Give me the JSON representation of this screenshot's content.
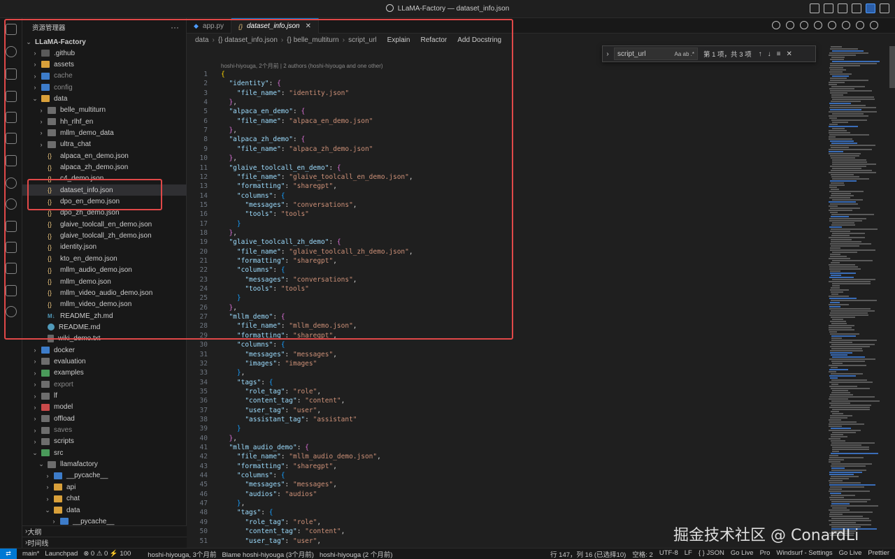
{
  "window": {
    "title": "LLaMA-Factory — dataset_info.json"
  },
  "sidebar": {
    "header": "资源管理器",
    "more": "···",
    "root": "LLaMA-Factory",
    "items": [
      {
        "label": ".github",
        "kind": "folder-github",
        "chev": "›",
        "indent": 1
      },
      {
        "label": "assets",
        "kind": "folder-orange",
        "chev": "›",
        "indent": 1
      },
      {
        "label": "cache",
        "kind": "folder-blue",
        "chev": "›",
        "indent": 1,
        "dim": true
      },
      {
        "label": "config",
        "kind": "folder-blue",
        "chev": "›",
        "indent": 1,
        "dim": true
      },
      {
        "label": "data",
        "kind": "folder-orange",
        "chev": "⌄",
        "indent": 1
      },
      {
        "label": "belle_multiturn",
        "kind": "folder",
        "chev": "›",
        "indent": 2
      },
      {
        "label": "hh_rlhf_en",
        "kind": "folder",
        "chev": "›",
        "indent": 2
      },
      {
        "label": "mllm_demo_data",
        "kind": "folder",
        "chev": "›",
        "indent": 2
      },
      {
        "label": "ultra_chat",
        "kind": "folder",
        "chev": "›",
        "indent": 2
      },
      {
        "label": "alpaca_en_demo.json",
        "kind": "json",
        "indent": 2
      },
      {
        "label": "alpaca_zh_demo.json",
        "kind": "json",
        "indent": 2
      },
      {
        "label": "c4_demo.json",
        "kind": "json",
        "indent": 2
      },
      {
        "label": "dataset_info.json",
        "kind": "json",
        "indent": 2,
        "selected": true
      },
      {
        "label": "dpo_en_demo.json",
        "kind": "json",
        "indent": 2
      },
      {
        "label": "dpo_zh_demo.json",
        "kind": "json",
        "indent": 2
      },
      {
        "label": "glaive_toolcall_en_demo.json",
        "kind": "json",
        "indent": 2
      },
      {
        "label": "glaive_toolcall_zh_demo.json",
        "kind": "json",
        "indent": 2
      },
      {
        "label": "identity.json",
        "kind": "json",
        "indent": 2
      },
      {
        "label": "kto_en_demo.json",
        "kind": "json",
        "indent": 2
      },
      {
        "label": "mllm_audio_demo.json",
        "kind": "json",
        "indent": 2
      },
      {
        "label": "mllm_demo.json",
        "kind": "json",
        "indent": 2
      },
      {
        "label": "mllm_video_audio_demo.json",
        "kind": "json",
        "indent": 2
      },
      {
        "label": "mllm_video_demo.json",
        "kind": "json",
        "indent": 2
      },
      {
        "label": "README_zh.md",
        "kind": "md",
        "indent": 2
      },
      {
        "label": "README.md",
        "kind": "info",
        "indent": 2
      },
      {
        "label": "wiki_demo.txt",
        "kind": "txt",
        "indent": 2
      },
      {
        "label": "docker",
        "kind": "folder-blue",
        "chev": "›",
        "indent": 1
      },
      {
        "label": "evaluation",
        "kind": "folder",
        "chev": "›",
        "indent": 1
      },
      {
        "label": "examples",
        "kind": "folder-green",
        "chev": "›",
        "indent": 1
      },
      {
        "label": "export",
        "kind": "folder",
        "chev": "›",
        "indent": 1,
        "dim": true
      },
      {
        "label": "lf",
        "kind": "folder",
        "chev": "›",
        "indent": 1
      },
      {
        "label": "model",
        "kind": "folder-red",
        "chev": "›",
        "indent": 1
      },
      {
        "label": "offload",
        "kind": "folder",
        "chev": "›",
        "indent": 1
      },
      {
        "label": "saves",
        "kind": "folder",
        "chev": "›",
        "indent": 1,
        "dim": true
      },
      {
        "label": "scripts",
        "kind": "folder",
        "chev": "›",
        "indent": 1
      },
      {
        "label": "src",
        "kind": "folder-green",
        "chev": "⌄",
        "indent": 1
      },
      {
        "label": "llamafactory",
        "kind": "folder",
        "chev": "⌄",
        "indent": 2
      },
      {
        "label": "__pycache__",
        "kind": "folder-blue",
        "chev": "›",
        "indent": 3
      },
      {
        "label": "api",
        "kind": "folder-orange",
        "chev": "›",
        "indent": 3
      },
      {
        "label": "chat",
        "kind": "folder-orange",
        "chev": "›",
        "indent": 3
      },
      {
        "label": "data",
        "kind": "folder-orange",
        "chev": "⌄",
        "indent": 3
      },
      {
        "label": "__pycache__",
        "kind": "folder-blue",
        "chev": "›",
        "indent": 4
      }
    ],
    "outline": "大纲",
    "timeline": "时间线"
  },
  "tabs": [
    {
      "label": "app.py",
      "icon": "python-icon"
    },
    {
      "label": "dataset_info.json",
      "icon": "json-icon",
      "active": true
    }
  ],
  "breadcrumb": {
    "items": [
      "data",
      "{} dataset_info.json",
      "{} belle_multiturn",
      "script_url"
    ],
    "actions": [
      "Explain",
      "Refactor",
      "Add Docstring"
    ]
  },
  "find": {
    "value": "script_url",
    "options": "Aa  ab  .*",
    "result": "第 1 项，共 3 项"
  },
  "blame_line": "hoshi-hiyouga, 2个月前 | 2 authors (hoshi-hiyouga and one other)",
  "code_lines": [
    {
      "n": "1",
      "t": "{"
    },
    {
      "n": "2",
      "t": "  \"identity\": {"
    },
    {
      "n": "3",
      "t": "    \"file_name\": \"identity.json\""
    },
    {
      "n": "4",
      "t": "  },"
    },
    {
      "n": "5",
      "t": "  \"alpaca_en_demo\": {"
    },
    {
      "n": "6",
      "t": "    \"file_name\": \"alpaca_en_demo.json\""
    },
    {
      "n": "7",
      "t": "  },"
    },
    {
      "n": "8",
      "t": "  \"alpaca_zh_demo\": {"
    },
    {
      "n": "9",
      "t": "    \"file_name\": \"alpaca_zh_demo.json\""
    },
    {
      "n": "10",
      "t": "  },"
    },
    {
      "n": "11",
      "t": "  \"glaive_toolcall_en_demo\": {"
    },
    {
      "n": "12",
      "t": "    \"file_name\": \"glaive_toolcall_en_demo.json\","
    },
    {
      "n": "13",
      "t": "    \"formatting\": \"sharegpt\","
    },
    {
      "n": "14",
      "t": "    \"columns\": {"
    },
    {
      "n": "15",
      "t": "      \"messages\": \"conversations\","
    },
    {
      "n": "16",
      "t": "      \"tools\": \"tools\""
    },
    {
      "n": "17",
      "t": "    }"
    },
    {
      "n": "18",
      "t": "  },"
    },
    {
      "n": "19",
      "t": "  \"glaive_toolcall_zh_demo\": {"
    },
    {
      "n": "20",
      "t": "    \"file_name\": \"glaive_toolcall_zh_demo.json\","
    },
    {
      "n": "21",
      "t": "    \"formatting\": \"sharegpt\","
    },
    {
      "n": "22",
      "t": "    \"columns\": {"
    },
    {
      "n": "23",
      "t": "      \"messages\": \"conversations\","
    },
    {
      "n": "24",
      "t": "      \"tools\": \"tools\""
    },
    {
      "n": "25",
      "t": "    }"
    },
    {
      "n": "26",
      "t": "  },"
    },
    {
      "n": "27",
      "t": "  \"mllm_demo\": {"
    },
    {
      "n": "28",
      "t": "    \"file_name\": \"mllm_demo.json\","
    },
    {
      "n": "29",
      "t": "    \"formatting\": \"sharegpt\","
    },
    {
      "n": "30",
      "t": "    \"columns\": {"
    },
    {
      "n": "31",
      "t": "      \"messages\": \"messages\","
    },
    {
      "n": "32",
      "t": "      \"images\": \"images\""
    },
    {
      "n": "33",
      "t": "    },"
    },
    {
      "n": "34",
      "t": "    \"tags\": {"
    },
    {
      "n": "35",
      "t": "      \"role_tag\": \"role\","
    },
    {
      "n": "36",
      "t": "      \"content_tag\": \"content\","
    },
    {
      "n": "37",
      "t": "      \"user_tag\": \"user\","
    },
    {
      "n": "38",
      "t": "      \"assistant_tag\": \"assistant\""
    },
    {
      "n": "39",
      "t": "    }"
    },
    {
      "n": "40",
      "t": "  },"
    },
    {
      "n": "41",
      "t": "  \"mllm_audio_demo\": {"
    },
    {
      "n": "42",
      "t": "    \"file_name\": \"mllm_audio_demo.json\","
    },
    {
      "n": "43",
      "t": "    \"formatting\": \"sharegpt\","
    },
    {
      "n": "44",
      "t": "    \"columns\": {"
    },
    {
      "n": "45",
      "t": "      \"messages\": \"messages\","
    },
    {
      "n": "46",
      "t": "      \"audios\": \"audios\""
    },
    {
      "n": "47",
      "t": "    },"
    },
    {
      "n": "48",
      "t": "    \"tags\": {"
    },
    {
      "n": "49",
      "t": "      \"role_tag\": \"role\","
    },
    {
      "n": "50",
      "t": "      \"content_tag\": \"content\","
    },
    {
      "n": "51",
      "t": "      \"user_tag\": \"user\","
    }
  ],
  "watermark": "掘金技术社区 @ ConardLi",
  "status": {
    "remote": "⇄",
    "branch": "main*",
    "launchpad": "Launchpad",
    "problems": "⊗ 0  ⚠ 0  ⚡ 100",
    "blame_short": "hoshi-hiyouga, 3个月前",
    "blame_long": "Blame hoshi-hiyouga (3个月前)",
    "author": "hoshi-hiyouga (2 个月前)",
    "position": "行 147，列 16 (已选择10)",
    "spaces": "空格: 2",
    "encoding": "UTF-8",
    "eol": "LF",
    "language": "{ } JSON",
    "golive1": "Go Live",
    "pro": "Pro",
    "windsurf": "Windsurf - Settings",
    "golive2": "Go Live",
    "prettier": "Prettier"
  },
  "colors": {
    "accent": "#0078d4",
    "highlight_box": "#e04848"
  }
}
